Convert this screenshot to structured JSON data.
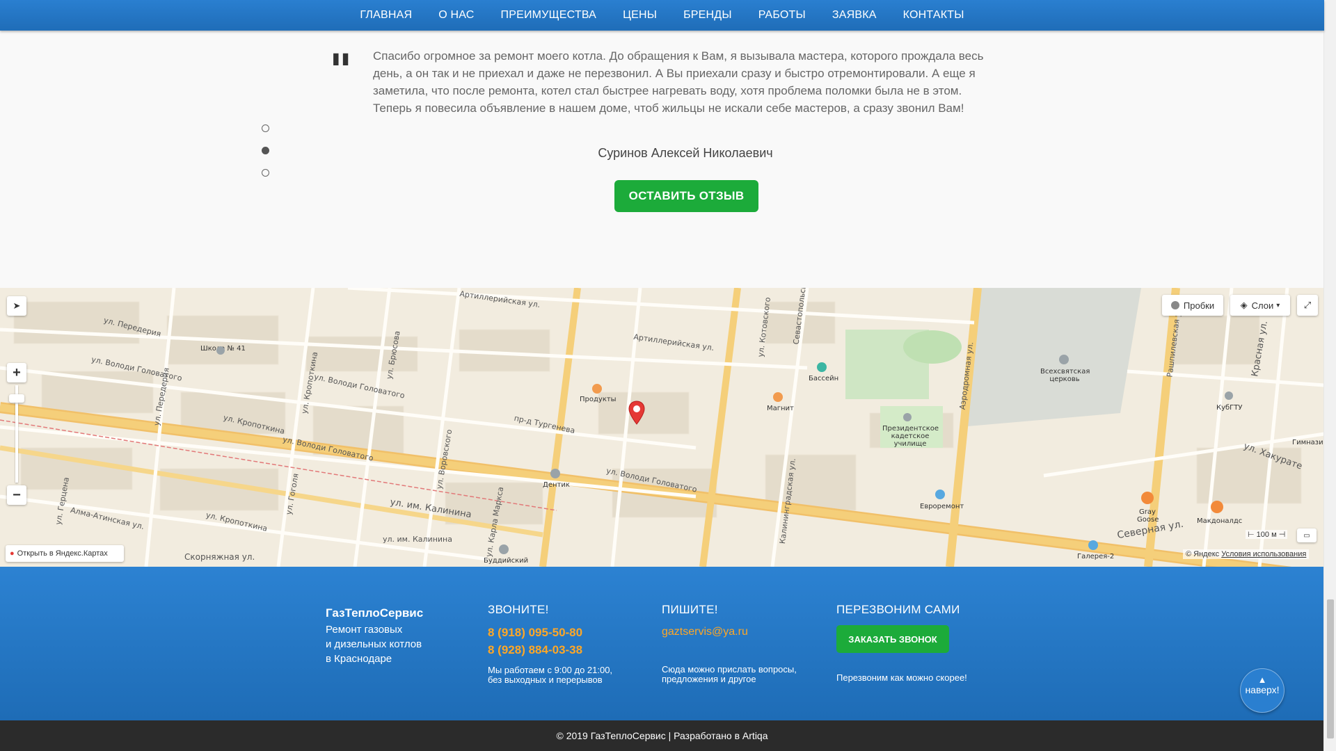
{
  "nav": {
    "items": [
      "ГЛАВНАЯ",
      "О НАС",
      "ПРЕИМУЩЕСТВА",
      "ЦЕНЫ",
      "БРЕНДЫ",
      "РАБОТЫ",
      "ЗАЯВКА",
      "КОНТАКТЫ"
    ]
  },
  "testimonial": {
    "text": "Спасибо огромное за ремонт моего котла. До обращения к Вам, я вызывала мастера, которого прождала весь день, а он так и не приехал и даже не перезвонил. А Вы приехали сразу и быстро отремонтировали. А еще я заметила, что после ремонта, котел стал быстрее нагревать воду, хотя проблема поломки была не в этом. Теперь я повесила объявление в нашем доме, чтоб жильцы не искали себе мастеров, а сразу звонил Вам!",
    "author": "Суринов Алексей Николаевич",
    "button": "ОСТАВИТЬ ОТЗЫВ",
    "active_slide": 2,
    "slide_count": 3
  },
  "map": {
    "traffic_button": "Пробки",
    "layers_button": "Слои",
    "open_link": "Открыть в Яндекс.Картах",
    "copyright": "© Яндекс",
    "terms": "Условия использования",
    "scale": "100 м",
    "streets": [
      "ул. Передерия",
      "Артиллерийская ул.",
      "Артиллерийская ул.",
      "ул. Володи Головатого",
      "ул. Володи Головатого",
      "ул. Володи Головатого",
      "ул. Володи Головатого",
      "ул. Кропоткина",
      "ул. Кропоткина",
      "ул. Кропоткина",
      "пр-д Тургенева",
      "ул. им. Калинина",
      "ул. им. Калинина",
      "Алма-Атинская ул.",
      "Скорняжная ул.",
      "Северная ул.",
      "ул. Котовского",
      "Аэродромная ул.",
      "Рашпилевская ул.",
      "Красная ул.",
      "ул. Хакурате",
      "ул. Брюсова",
      "ул. Воровского",
      "ул. Карла Маркса",
      "Калининградская ул.",
      "ул. Гоголя",
      "ул. Передерия",
      "ул. Герцена",
      "Севастопольская"
    ],
    "pois": [
      "Школа № 41",
      "Продукты",
      "Бассейн",
      "Магнит",
      "Всехсвятская церковь",
      "Президентское кадетское училище",
      "КубГТУ",
      "Гимназия",
      "Дентик",
      "Евроремонт",
      "Gray Goose",
      "Макдоналдс",
      "Галерея-2",
      "Буддийский"
    ]
  },
  "footer": {
    "brand": "ГазТеплоСервис",
    "desc": [
      "Ремонт газовых",
      "и дизельных котлов",
      "в Краснодаре"
    ],
    "call_title": "ЗВОНИТЕ!",
    "phones": [
      "8 (918) 095-50-80",
      "8 (928) 884-03-38"
    ],
    "hours": [
      "Мы работаем с 9:00 до 21:00,",
      "без выходных и перерывов"
    ],
    "write_title": "ПИШИТЕ!",
    "email": "gaztservis@ya.ru",
    "write_note": [
      "Сюда можно прислать вопросы,",
      "предложения и другое"
    ],
    "callback_title": "ПЕРЕЗВОНИМ САМИ",
    "callback_button": "ЗАКАЗАТЬ ЗВОНОК",
    "callback_note": "Перезвоним как можно скорее!",
    "to_top": "наверх!",
    "copyright": "© 2019 ГазТеплоСервис | Разработано в Artiqa"
  },
  "colors": {
    "nav_blue": "#2a7fd0",
    "green_button": "#1cab3a",
    "accent_orange": "#ffa726",
    "bottom_bar": "#2b2b2b"
  }
}
